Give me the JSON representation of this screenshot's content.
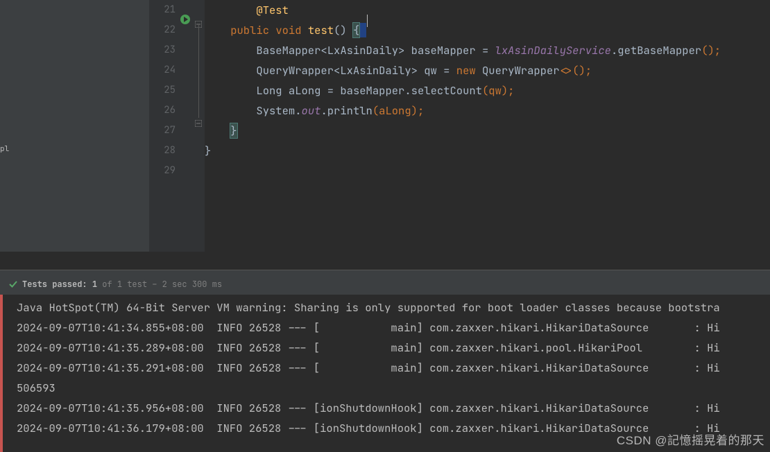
{
  "side": {
    "tree_label": "pl"
  },
  "editor": {
    "lines": [
      21,
      22,
      23,
      24,
      25,
      26,
      27,
      28,
      29
    ],
    "code": {
      "l21_pre": "        ",
      "l21_anno": "@Test",
      "l22_pre": "    ",
      "l22_kw1": "public",
      "l22_sp1": " ",
      "l22_kw2": "void",
      "l22_sp2": " ",
      "l22_m": "test",
      "l22_p": "() ",
      "l22_b": "{",
      "l23_pre": "        ",
      "l23_t": "BaseMapper",
      "l23_g1": "<",
      "l23_t2": "LxAsinDaily",
      "l23_g2": "> ",
      "l23_v": "baseMapper ",
      "l23_eq": "= ",
      "l23_f": "lxAsinDailyService",
      "l23_d": ".",
      "l23_m": "getBaseMapper",
      "l23_p": "();",
      "l24_pre": "        ",
      "l24_t": "QueryWrapper",
      "l24_g1": "<",
      "l24_t2": "LxAsinDaily",
      "l24_g2": "> ",
      "l24_v": "qw ",
      "l24_eq": "= ",
      "l24_kw": "new ",
      "l24_c": "QueryWrapper",
      "l24_d": "<>();",
      "l25_pre": "        ",
      "l25_t": "Long ",
      "l25_v": "aLong ",
      "l25_eq": "= ",
      "l25_o": "baseMapper",
      "l25_d": ".",
      "l25_m": "selectCount",
      "l25_p": "(qw);",
      "l26_pre": "        ",
      "l26_c": "System",
      "l26_d1": ".",
      "l26_f": "out",
      "l26_d2": ".",
      "l26_m": "println",
      "l26_p": "(aLong);",
      "l27_pre": "    ",
      "l27_b": "}",
      "l28_pre": "",
      "l28_b": "}"
    }
  },
  "status": {
    "prefix": "Tests passed: ",
    "count": "1",
    "suffix": " of 1 test – 2 sec 300 ms"
  },
  "console": {
    "warn": "Java HotSpot(TM) 64-Bit Server VM warning: Sharing is only supported for boot loader classes because bootstra",
    "r1": "2024-09-07T10:41:34.855+08:00  INFO 26528 --- [           main] com.zaxxer.hikari.HikariDataSource       : Hi",
    "r2": "2024-09-07T10:41:35.289+08:00  INFO 26528 --- [           main] com.zaxxer.hikari.pool.HikariPool        : Hi",
    "r3": "2024-09-07T10:41:35.291+08:00  INFO 26528 --- [           main] com.zaxxer.hikari.HikariDataSource       : Hi",
    "r4": "506593",
    "r5": "2024-09-07T10:41:35.956+08:00  INFO 26528 --- [ionShutdownHook] com.zaxxer.hikari.HikariDataSource       : Hi",
    "r6": "2024-09-07T10:41:36.179+08:00  INFO 26528 --- [ionShutdownHook] com.zaxxer.hikari.HikariDataSource       : Hi"
  },
  "watermark": "CSDN @記憶摇晃着的那天"
}
